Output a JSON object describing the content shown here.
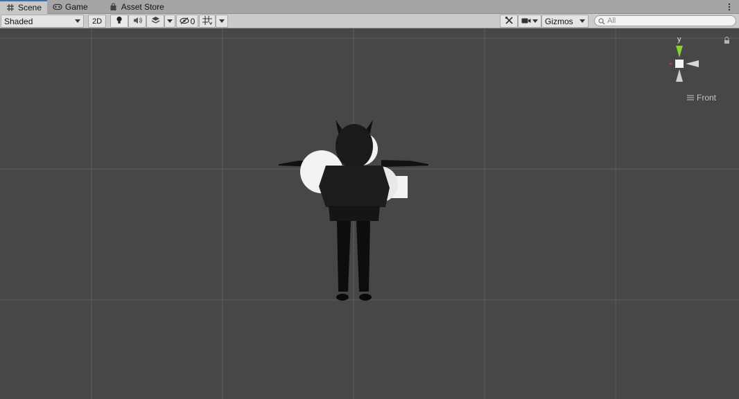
{
  "tabs": [
    {
      "label": "Scene",
      "icon": "grid-icon",
      "active": true
    },
    {
      "label": "Game",
      "icon": "gamepad-icon",
      "active": false
    },
    {
      "label": "Asset Store",
      "icon": "shopping-bag-icon",
      "active": false
    }
  ],
  "toolbar": {
    "draw_mode": "Shaded",
    "mode_2d": "2D",
    "hidden_count": "0",
    "gizmos": "Gizmos",
    "search_placeholder": "All"
  },
  "gizmo": {
    "y_label": "y",
    "x_label": "x",
    "view_label": "Front",
    "x_color": "#e0331d",
    "y_color": "#8ad12d"
  },
  "colors": {
    "scene_bg": "#474747",
    "grid_line": "#5f5f5f",
    "tab_accent": "#3a72b0"
  }
}
